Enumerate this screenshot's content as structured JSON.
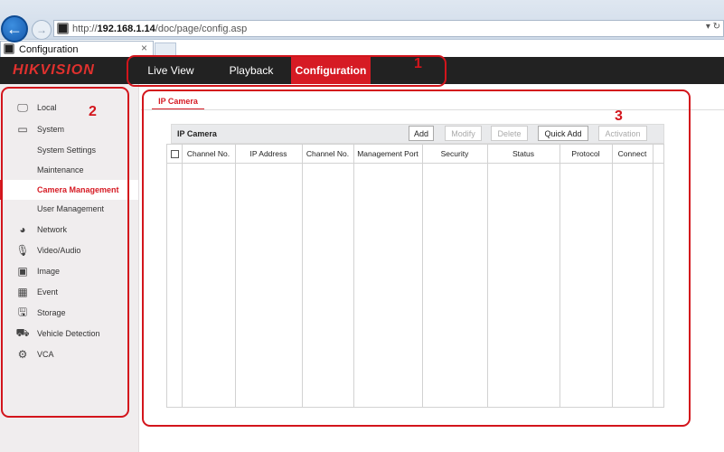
{
  "browser": {
    "url_prefix": "http://",
    "url_host": "192.168.1.14",
    "url_path": "/doc/page/config.asp",
    "address_tools": "▾ ↻",
    "tab_title": "Configuration",
    "tab_close": "×"
  },
  "header": {
    "logo": "HIKVISION",
    "nav": {
      "live_view": "Live View",
      "playback": "Playback",
      "configuration": "Configuration"
    }
  },
  "sidebar": {
    "items": [
      {
        "label": "Local",
        "icon": "monitor-icon",
        "glyph": "🖵"
      },
      {
        "label": "System",
        "icon": "system-icon",
        "glyph": "▭"
      },
      {
        "label": "System Settings"
      },
      {
        "label": "Maintenance"
      },
      {
        "label": "Camera Management"
      },
      {
        "label": "User Management"
      },
      {
        "label": "Network",
        "icon": "network-globe-icon",
        "glyph": "◕"
      },
      {
        "label": "Video/Audio",
        "icon": "video-audio-icon",
        "glyph": "🎙"
      },
      {
        "label": "Image",
        "icon": "image-icon",
        "glyph": "▣"
      },
      {
        "label": "Event",
        "icon": "event-calendar-icon",
        "glyph": "▦"
      },
      {
        "label": "Storage",
        "icon": "storage-icon",
        "glyph": "🖫"
      },
      {
        "label": "Vehicle Detection",
        "icon": "vehicle-detection-icon",
        "glyph": "⛟"
      },
      {
        "label": "VCA",
        "icon": "vca-icon",
        "glyph": "⚙"
      }
    ]
  },
  "main": {
    "tab": "IP Camera",
    "panel_title": "IP Camera",
    "buttons": {
      "add": "Add",
      "modify": "Modify",
      "delete": "Delete",
      "quick_add": "Quick Add",
      "activation": "Activation"
    },
    "columns": [
      "Channel No.",
      "IP Address",
      "Channel No.",
      "Management Port",
      "Security",
      "Status",
      "Protocol",
      "Connect"
    ]
  },
  "annotations": {
    "one": "1",
    "two": "2",
    "three": "3"
  },
  "colors": {
    "brand_red": "#d61b24",
    "annotation_red": "#d3151c",
    "nav_bg": "#222222"
  }
}
